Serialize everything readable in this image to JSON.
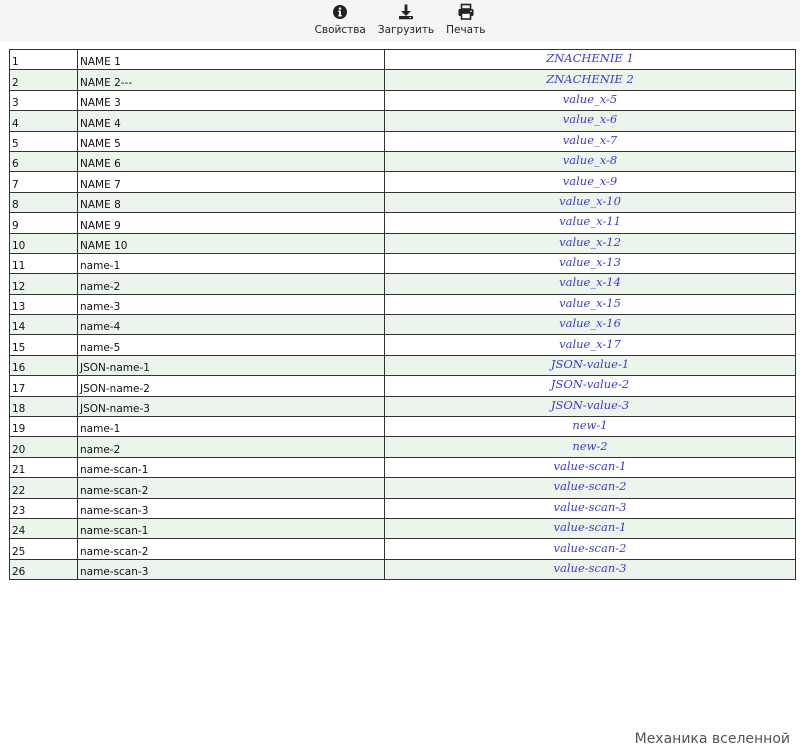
{
  "toolbar": {
    "properties_label": "Свойства",
    "download_label": "Загрузить",
    "print_label": "Печать"
  },
  "rows": [
    {
      "num": "1",
      "name": "NAME 1",
      "value": "ZNACHENIE 1"
    },
    {
      "num": "2",
      "name": "NAME 2---",
      "value": "ZNACHENIE 2"
    },
    {
      "num": "3",
      "name": "NAME 3",
      "value": "value_x-5"
    },
    {
      "num": "4",
      "name": "NAME 4",
      "value": "value_x-6"
    },
    {
      "num": "5",
      "name": "NAME 5",
      "value": "value_x-7"
    },
    {
      "num": "6",
      "name": "NAME 6",
      "value": "value_x-8"
    },
    {
      "num": "7",
      "name": "NAME 7",
      "value": "value_x-9"
    },
    {
      "num": "8",
      "name": "NAME 8",
      "value": "value_x-10"
    },
    {
      "num": "9",
      "name": "NAME 9",
      "value": "value_x-11"
    },
    {
      "num": "10",
      "name": "NAME 10",
      "value": "value_x-12"
    },
    {
      "num": "11",
      "name": "name-1",
      "value": "value_x-13"
    },
    {
      "num": "12",
      "name": "name-2",
      "value": "value_x-14"
    },
    {
      "num": "13",
      "name": "name-3",
      "value": "value_x-15"
    },
    {
      "num": "14",
      "name": "name-4",
      "value": "value_x-16"
    },
    {
      "num": "15",
      "name": "name-5",
      "value": "value_x-17"
    },
    {
      "num": "16",
      "name": "JSON-name-1",
      "value": "JSON-value-1"
    },
    {
      "num": "17",
      "name": "JSON-name-2",
      "value": "JSON-value-2"
    },
    {
      "num": "18",
      "name": "JSON-name-3",
      "value": "JSON-value-3"
    },
    {
      "num": "19",
      "name": "name-1",
      "value": "new-1"
    },
    {
      "num": "20",
      "name": "name-2",
      "value": "new-2"
    },
    {
      "num": "21",
      "name": "name-scan-1",
      "value": "value-scan-1"
    },
    {
      "num": "22",
      "name": "name-scan-2",
      "value": "value-scan-2"
    },
    {
      "num": "23",
      "name": "name-scan-3",
      "value": "value-scan-3"
    },
    {
      "num": "24",
      "name": "name-scan-1",
      "value": "value-scan-1"
    },
    {
      "num": "25",
      "name": "name-scan-2",
      "value": "value-scan-2"
    },
    {
      "num": "26",
      "name": "name-scan-3",
      "value": "value-scan-3"
    }
  ],
  "footer": {
    "text": "Механика вселенной"
  },
  "colors": {
    "toolbar_bg": "#f5f5f5",
    "row_alt_bg": "#ecf5ec",
    "value_text": "#3b3bd6",
    "border": "#333333"
  },
  "icons": {
    "properties": "info-circle-icon",
    "download": "download-icon",
    "print": "print-icon"
  }
}
